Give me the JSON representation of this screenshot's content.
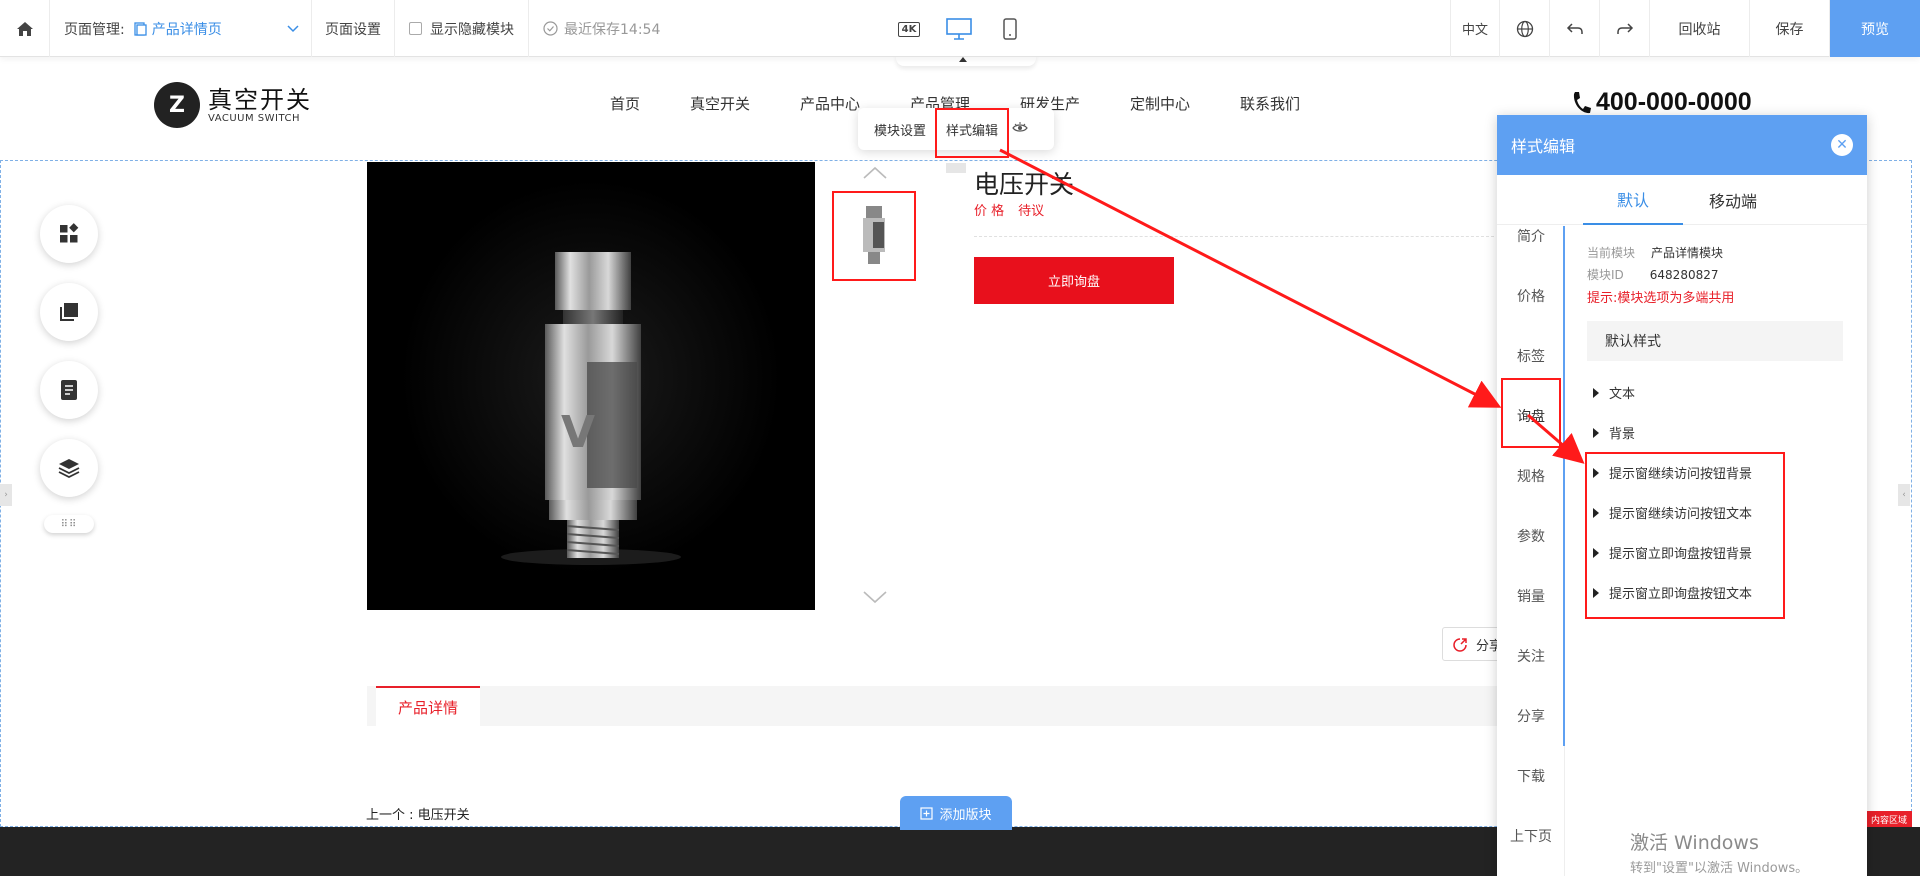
{
  "toolbar": {
    "page_manage_label": "页面管理:",
    "current_page": "产品详情页",
    "page_settings": "页面设置",
    "show_hidden_modules": "显示隐藏模块",
    "last_saved": "最近保存14:54",
    "device_4k": "4K",
    "language": "中文",
    "recycle_bin": "回收站",
    "save": "保存",
    "preview": "预览"
  },
  "site": {
    "logo_cn": "真空开关",
    "logo_en": "VACUUM SWITCH",
    "nav": [
      "首页",
      "真空开关",
      "产品中心",
      "产品管理",
      "研发生产",
      "定制中心",
      "联系我们"
    ],
    "phone": "400-000-0000"
  },
  "module_popup": {
    "module_settings": "模块设置",
    "style_edit": "样式编辑"
  },
  "product": {
    "name": "电压开关",
    "price_label": "价 格",
    "price_value": "待议",
    "inquire_button": "立即询盘",
    "share_label": "分享",
    "detail_tab": "产品详情",
    "prev_link": "上一个 : 电压开关"
  },
  "add_block": "添加版块",
  "area_tag": "内容区域",
  "panel": {
    "title": "样式编辑",
    "tabs": [
      "默认",
      "移动端"
    ],
    "left_items": [
      "简介",
      "价格",
      "标签",
      "询盘",
      "规格",
      "参数",
      "销量",
      "关注",
      "分享",
      "下载",
      "上下页"
    ],
    "current_module_label": "当前模块",
    "current_module_value": "产品详情模块",
    "module_id_label": "模块ID",
    "module_id_value": "648280827",
    "tip": "提示:模块选项为多端共用",
    "default_style": "默认样式",
    "rows": [
      "文本",
      "背景",
      "提示窗继续访问按钮背景",
      "提示窗继续访问按钮文本",
      "提示窗立即询盘按钮背景",
      "提示窗立即询盘按钮文本"
    ]
  },
  "watermark": {
    "line1": "激活 Windows",
    "line2": "转到\"设置\"以激活 Windows。"
  },
  "colors": {
    "accent_blue": "#5ea0f2",
    "brand_red": "#e8101c",
    "annotation_red": "#ff1a1a"
  }
}
